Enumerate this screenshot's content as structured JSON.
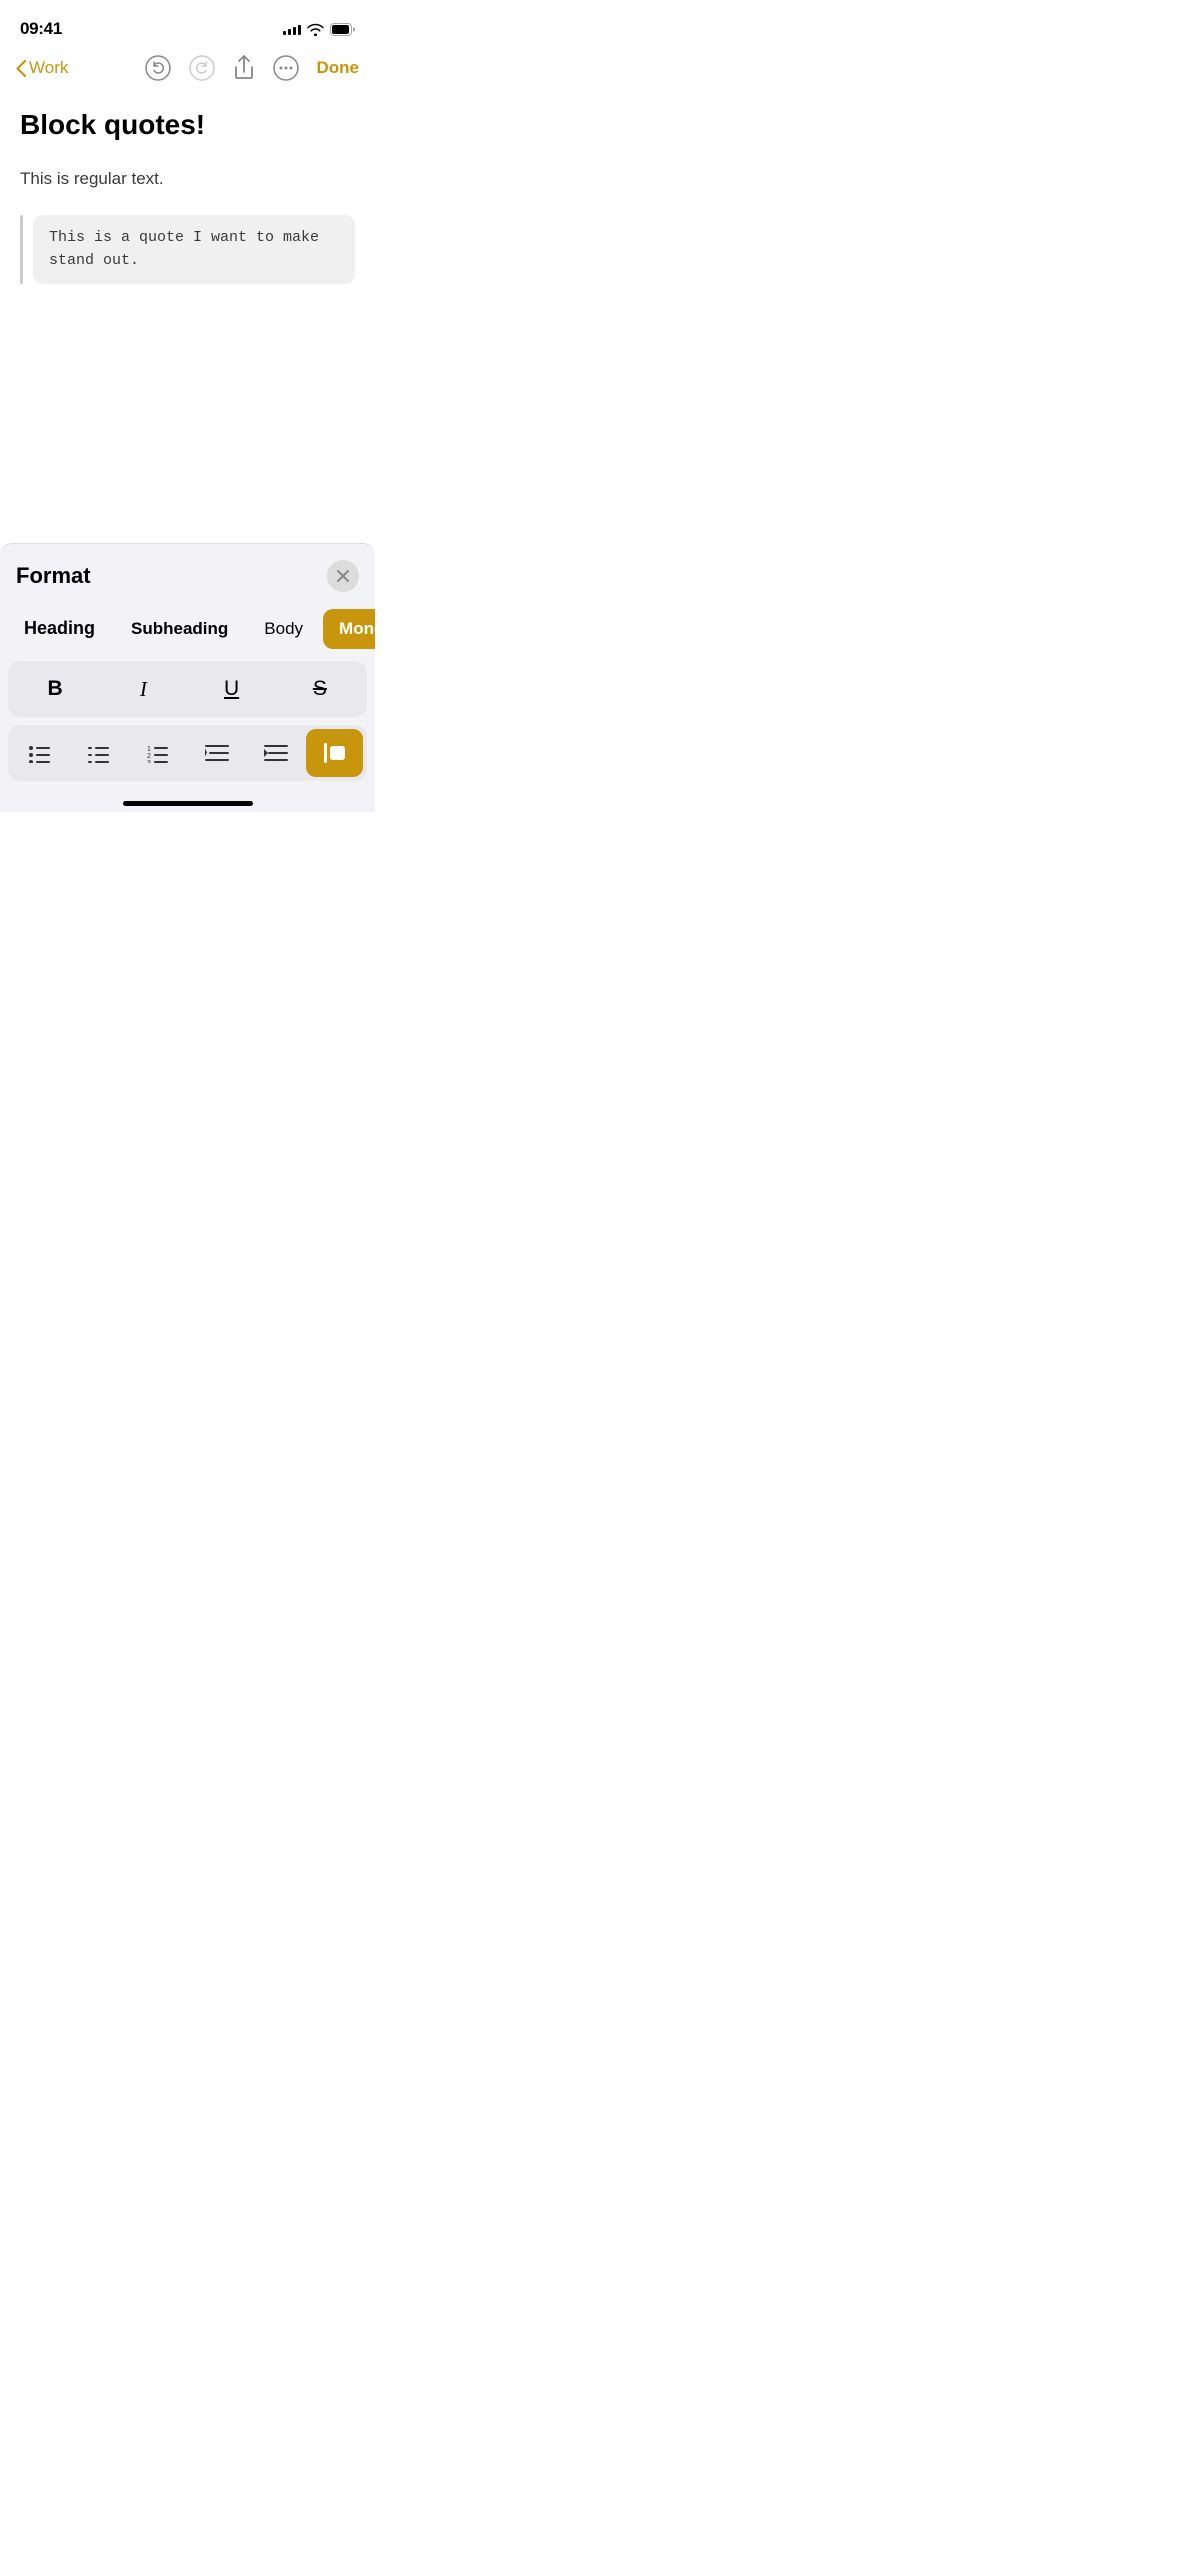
{
  "statusBar": {
    "time": "09:41",
    "signalBars": [
      4,
      6,
      8,
      10,
      12
    ],
    "batteryLevel": 100
  },
  "nav": {
    "backLabel": "Work",
    "undoLabel": "Undo",
    "redoLabel": "Redo",
    "shareLabel": "Share",
    "moreLabel": "More",
    "doneLabel": "Done"
  },
  "document": {
    "title": "Block quotes!",
    "bodyText": "This is regular text.",
    "blockQuote": "This is a quote I want to make stand out."
  },
  "formatPanel": {
    "title": "Format",
    "closeLabel": "×",
    "styles": [
      {
        "id": "heading",
        "label": "Heading",
        "active": false
      },
      {
        "id": "subheading",
        "label": "Subheading",
        "active": false
      },
      {
        "id": "body",
        "label": "Body",
        "active": false
      },
      {
        "id": "monostyled",
        "label": "Monostyled",
        "active": true
      }
    ],
    "formatting": [
      {
        "id": "bold",
        "symbol": "B",
        "bold": true
      },
      {
        "id": "italic",
        "symbol": "I",
        "italic": true
      },
      {
        "id": "underline",
        "symbol": "U",
        "underline": true
      },
      {
        "id": "strikethrough",
        "symbol": "S",
        "strikethrough": true
      }
    ],
    "listOptions": [
      {
        "id": "bullet-list",
        "type": "bullet"
      },
      {
        "id": "dash-list",
        "type": "dash"
      },
      {
        "id": "numbered-list",
        "type": "numbered"
      },
      {
        "id": "align-right",
        "type": "align-right"
      },
      {
        "id": "indent",
        "type": "indent"
      },
      {
        "id": "block-quote",
        "type": "block-quote",
        "active": true
      }
    ]
  },
  "colors": {
    "accent": "#C8960C",
    "accentActive": "#C8960C",
    "panelBg": "#f2f2f7",
    "rowBg": "#e8e8ed"
  }
}
